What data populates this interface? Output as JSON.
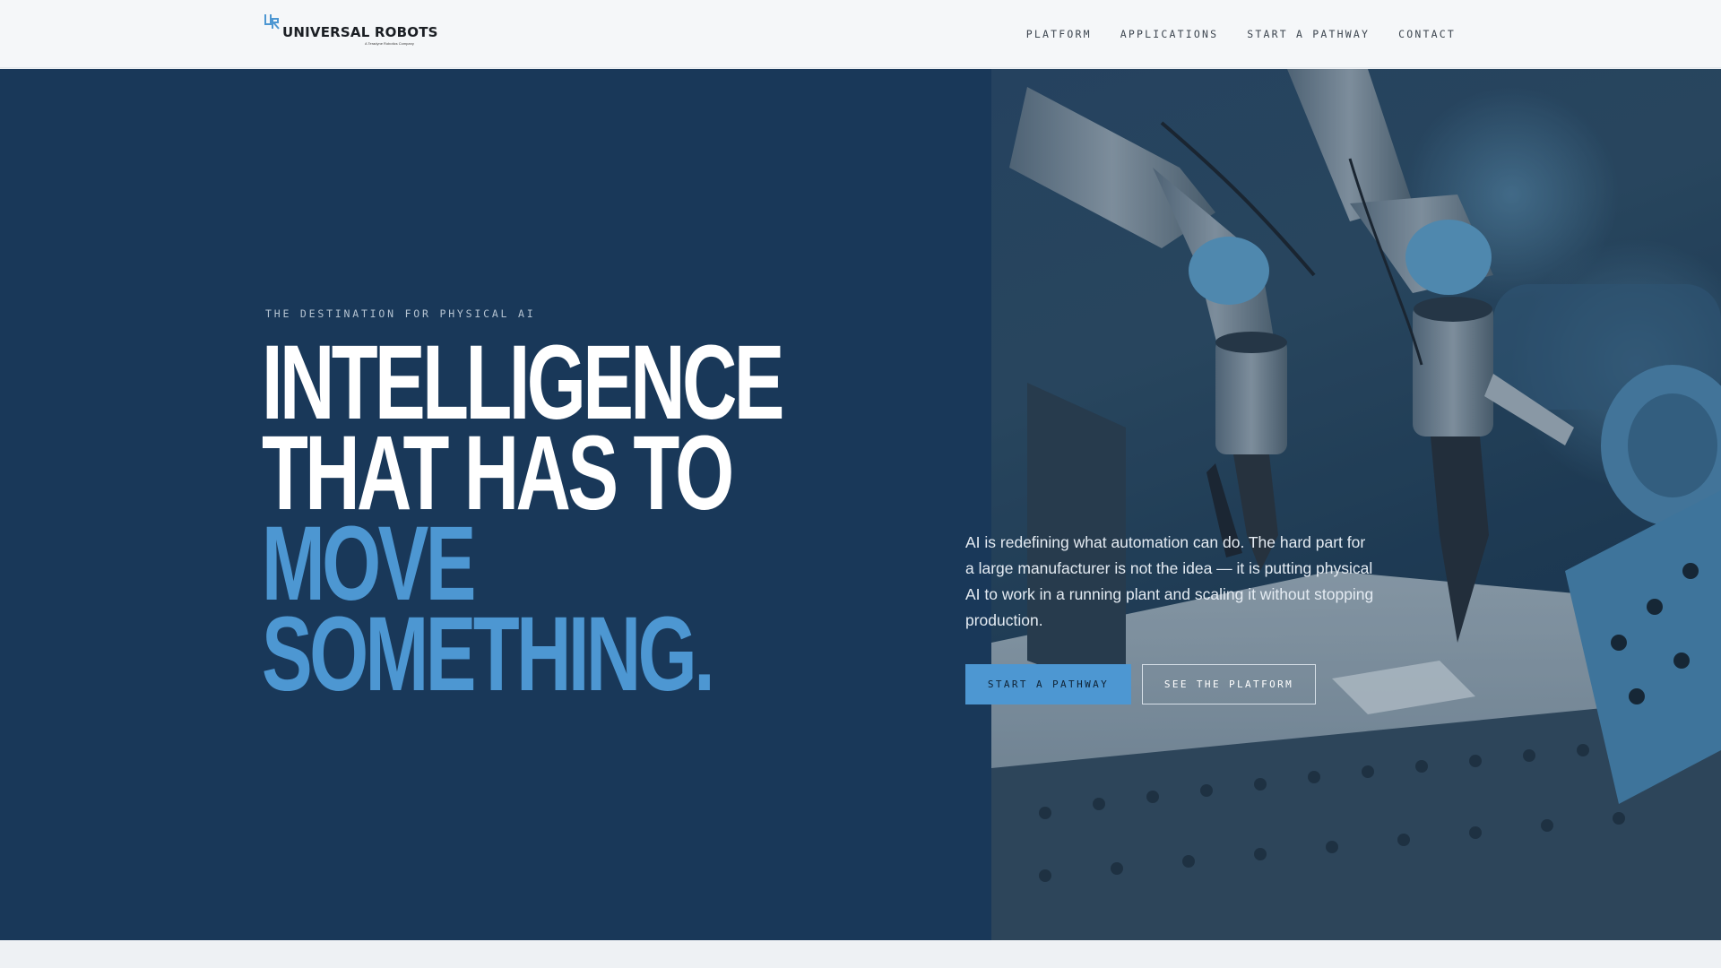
{
  "brand": {
    "name": "UNIVERSAL ROBOTS",
    "tagline": "A Teradyne Robotics Company",
    "accent": "#4d97d2",
    "navy": "#193859"
  },
  "nav": {
    "items": [
      {
        "label": "PLATFORM"
      },
      {
        "label": "APPLICATIONS"
      },
      {
        "label": "START A PATHWAY"
      },
      {
        "label": "CONTACT"
      }
    ]
  },
  "hero": {
    "eyebrow": "THE DESTINATION FOR PHYSICAL AI",
    "headline": {
      "line1": "INTELLIGENCE",
      "line2": "THAT HAS TO",
      "line3": "MOVE",
      "line4": "SOMETHING."
    },
    "intro": "AI is redefining what automation can do. The hard part for a large manufacturer is not the idea — it is putting physical AI to work in a running plant and scaling it without stopping production.",
    "primary_cta": "START A PATHWAY",
    "secondary_cta": "SEE THE PLATFORM",
    "image_subject": "robot-arms-photo"
  }
}
